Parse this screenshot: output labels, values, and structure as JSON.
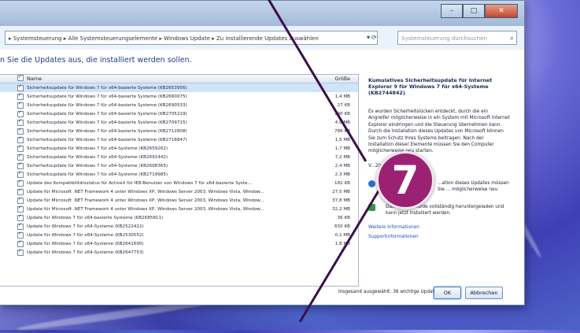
{
  "window": {
    "buttons": {
      "minimize": "–",
      "maximize": "□",
      "close": "✕"
    }
  },
  "address": {
    "path": "▸ Systemsteuerung ▸ Alle Systemsteuerungselemente ▸ Windows Update ▸ Zu installierende Updates auswählen",
    "search_placeholder": "Systemsteuerung durchsuchen"
  },
  "heading": "n Sie die Updates aus, die installiert werden sollen.",
  "list": {
    "col_name": "Name",
    "col_size": "Größe",
    "rows": [
      {
        "name": "Sicherheitsupdate für Windows 7 für x64-basierte Systeme (KB2653956)",
        "size": ""
      },
      {
        "name": "Sicherheitsupdate für Windows 7 für x64-basierte Systeme (KB2660075)",
        "size": "1,4 MB"
      },
      {
        "name": "Sicherheitsupdate für Windows 7 für x64-basierte Systeme (KB2690533)",
        "size": "27 KB"
      },
      {
        "name": "Sicherheitsupdate für Windows 7 für x64-basierte Systeme (KB2705219)",
        "size": "190 KB"
      },
      {
        "name": "Sicherheitsupdate für Windows 7 für x64-basierte Systeme (KB2709715)",
        "size": "4,9 MB"
      },
      {
        "name": "Sicherheitsupdate für Windows 7 für x64-basierte Systeme (KB2712808)",
        "size": "786 KB"
      },
      {
        "name": "Sicherheitsupdate für Windows 7 für x64-basierte Systeme (KB2718847)",
        "size": "1,5 MB"
      },
      {
        "name": "Sicherheitsupdate für Windows 7 für x64-Systeme (KB2659262)",
        "size": "1,7 MB"
      },
      {
        "name": "Sicherheitsupdate für Windows 7 für x64-Systeme (KB2691442)",
        "size": "7,2 MB"
      },
      {
        "name": "Sicherheitsupdate für Windows 7 für x64-Systeme (KB2698365)",
        "size": "2,4 MB"
      },
      {
        "name": "Sicherheitsupdate für Windows 7 für x64-Systeme (KB2719985)",
        "size": "2,3 MB"
      },
      {
        "name": "Update des Kompatibilitätsstatus für ActiveX für IE8-Benutzer von Windows 7 für x64-basierte Syste...",
        "size": "182 KB"
      },
      {
        "name": "Update für Microsoft .NET Framework 4 unter Windows XP, Windows Server 2003, Windows Vista, Window...",
        "size": "27,5 MB"
      },
      {
        "name": "Update für Microsoft .NET Framework 4 unter Windows XP, Windows Server 2003, Windows Vista, Window...",
        "size": "37,8 MB"
      },
      {
        "name": "Update für Microsoft .NET Framework 4 unter Windows XP, Windows Server 2003, Windows Vista, Window...",
        "size": "32,2 MB"
      },
      {
        "name": "Update für Windows 7 für x64-basierte Systeme (KB2685811)",
        "size": "36 KB"
      },
      {
        "name": "Update für Windows 7 für x64-Systeme (KB2522422)",
        "size": "650 KB"
      },
      {
        "name": "Update für Windows 7 für x64-Systeme (KB2530552)",
        "size": "0,1 MB"
      },
      {
        "name": "Update für Windows 7 für x64-Systeme (KB2641690)",
        "size": "1,8 MB"
      },
      {
        "name": "Update für Windows 7 für x64-Systeme (KB2647753)",
        "size": ""
      }
    ]
  },
  "details": {
    "title": "Kumulatives Sicherheitsupdate für Internet Explorer 9 für Windows 7 für x64-Systeme (KB2744842)",
    "text": "Es wurden Sicherheitslücken entdeckt, durch die ein Angreifer möglicherweise in ein System mit Microsoft Internet Explorer eindringen und die Steuerung übernehmen kann. Durch die Installation dieses Updates von Microsoft können Sie zum Schutz Ihres Systems beitragen. Nach der Installation dieser Elemente müssen Sie den Computer möglicherweise neu starten.",
    "version": "V...2012",
    "warning": "...ation dieses Updates müssen Sie ... möglicherweise neu",
    "downloaded": "Das Update wurde vollständig heruntergeladen und kann jetzt installiert werden.",
    "link_more": "Weitere Informationen",
    "link_support": "Supportinformationen"
  },
  "footer": {
    "status": "Insgesamt ausgewählt: 38 wichtige Updates",
    "ok": "OK",
    "cancel": "Abbrechen"
  },
  "badge": "7",
  "colors": {
    "badge": "#9b2273",
    "link": "#1a55b8",
    "heading": "#1e3a8a"
  }
}
